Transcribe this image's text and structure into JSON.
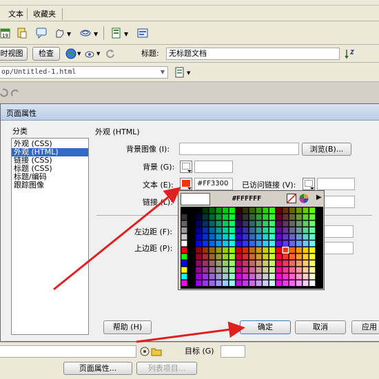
{
  "menubar": {
    "items": [
      "文本",
      "收藏夹"
    ]
  },
  "doc_toolbar": {
    "view_tab_partial": "时视图",
    "inspect_label": "检查",
    "title_label": "标题:",
    "title_value": "无标题文档"
  },
  "address": {
    "value": "op/Untitled-1.html"
  },
  "dialog": {
    "title": "页面属性",
    "category_label": "分类",
    "categories": [
      "外观 (CSS)",
      "外观 (HTML)",
      "链接 (CSS)",
      "标题 (CSS)",
      "标题/编码",
      "跟踪图像"
    ],
    "selected_category_index": 1,
    "section_title": "外观 (HTML)",
    "bg_image_label": "背景图像 (I):",
    "browse_label": "浏览(B)...",
    "bg_label": "背景 (G):",
    "text_label": "文本 (E):",
    "text_color_value": "#FF3300",
    "text_color_hex": "#FF3300",
    "visited_label": "已访问链接 (V):",
    "link_label": "链接 (L):",
    "left_margin_label": "左边距 (F):",
    "top_margin_label": "上边距 (P):",
    "help_label": "帮助 (H)",
    "ok_label": "确定",
    "cancel_label": "取消",
    "apply_label": "应用"
  },
  "color_picker": {
    "preview_hex_value": "#FFFFFF",
    "selected_color": "#FF3300"
  },
  "bottom_panel": {
    "page_props_label": "页面属性...",
    "list_items_label": "列表项目...",
    "target_label": "目标 (G)"
  },
  "annotation_color": "#e02020"
}
